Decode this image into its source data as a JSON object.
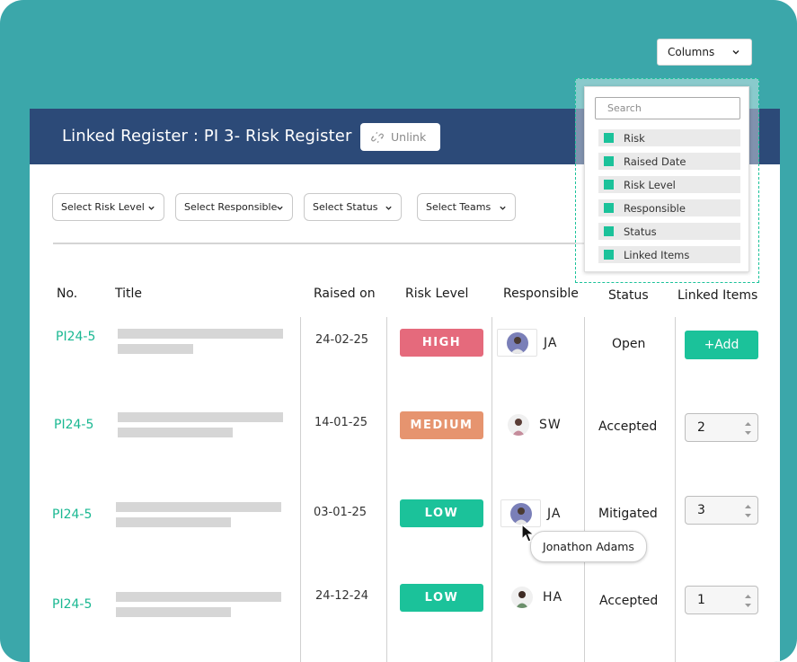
{
  "colors": {
    "background": "#3ba7aa",
    "header": "#2c4a78",
    "accent": "#1bc29a",
    "high": "#e56a7c",
    "medium": "#e6946f",
    "low": "#1bc29a"
  },
  "toolbar": {
    "columns_label": "Columns"
  },
  "header": {
    "title": "Linked Register : PI 3- Risk Register",
    "unlink_label": "Unlink"
  },
  "filters": [
    "Select Risk Level",
    "Select Responsible",
    "Select Status",
    "Select Teams"
  ],
  "table": {
    "headers": [
      "No.",
      "Title",
      "Raised on",
      "Risk Level",
      "Responsible",
      "Status",
      "Linked Items"
    ],
    "rows": [
      {
        "no": "PI24-5",
        "raised": "24-02-25",
        "risk": "HIGH",
        "initials": "JA",
        "status": "Open",
        "linked": "+Add"
      },
      {
        "no": "PI24-5",
        "raised": "14-01-25",
        "risk": "MEDIUM",
        "initials": "SW",
        "status": "Accepted",
        "linked": "2"
      },
      {
        "no": "PI24-5",
        "raised": "03-01-25",
        "risk": "LOW",
        "initials": "JA",
        "status": "Mitigated",
        "linked": "3"
      },
      {
        "no": "PI24-5",
        "raised": "24-12-24",
        "risk": "LOW",
        "initials": "HA",
        "status": "Accepted",
        "linked": "1"
      }
    ]
  },
  "tooltip": {
    "text": "Jonathon Adams"
  },
  "columns_menu": {
    "search_placeholder": "Search",
    "items": [
      "Risk",
      "Raised Date",
      "Risk Level",
      "Responsible",
      "Status",
      "Linked Items"
    ]
  }
}
